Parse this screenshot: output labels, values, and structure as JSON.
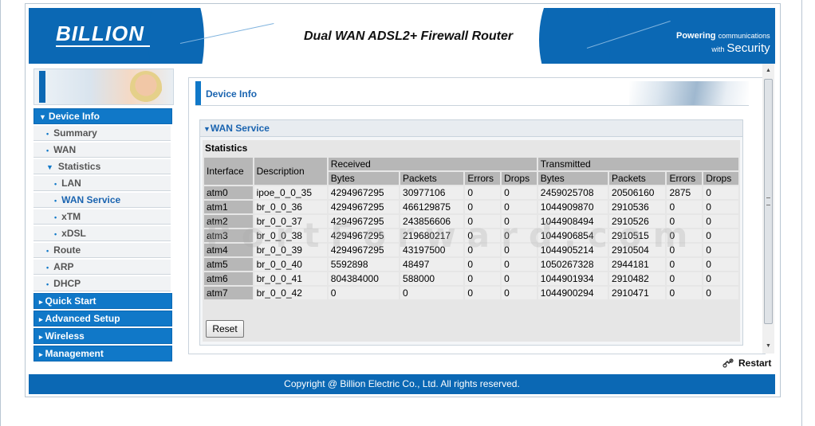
{
  "header": {
    "logo": "BILLION",
    "title": "Dual WAN ADSL2+ Firewall Router",
    "tagline_line1_a": "Powering",
    "tagline_line1_b": "communications",
    "tagline_line2_a": "with",
    "tagline_line2_b": "Security"
  },
  "sidebar": {
    "items": [
      {
        "label": "Device Info",
        "level": "head",
        "expanded": true
      },
      {
        "label": "Summary",
        "level": "sub1"
      },
      {
        "label": "WAN",
        "level": "sub1"
      },
      {
        "label": "Statistics",
        "level": "sub1",
        "expanded": true
      },
      {
        "label": "LAN",
        "level": "sub2"
      },
      {
        "label": "WAN Service",
        "level": "sub2",
        "active": true
      },
      {
        "label": "xTM",
        "level": "sub2"
      },
      {
        "label": "xDSL",
        "level": "sub2"
      },
      {
        "label": "Route",
        "level": "sub1"
      },
      {
        "label": "ARP",
        "level": "sub1"
      },
      {
        "label": "DHCP",
        "level": "sub1"
      },
      {
        "label": "Quick Start",
        "level": "head"
      },
      {
        "label": "Advanced Setup",
        "level": "head"
      },
      {
        "label": "Wireless",
        "level": "head"
      },
      {
        "label": "Management",
        "level": "head"
      }
    ]
  },
  "main": {
    "title": "Device Info",
    "section": "WAN Service",
    "stats_label": "Statistics",
    "headers": {
      "interface": "Interface",
      "description": "Description",
      "received": "Received",
      "transmitted": "Transmitted",
      "bytes": "Bytes",
      "packets": "Packets",
      "errors": "Errors",
      "drops": "Drops"
    },
    "rows": [
      [
        "atm0",
        "ipoe_0_0_35",
        "4294967295",
        "30977106",
        "0",
        "0",
        "2459025708",
        "20506160",
        "2875",
        "0"
      ],
      [
        "atm1",
        "br_0_0_36",
        "4294967295",
        "466129875",
        "0",
        "0",
        "1044909870",
        "2910536",
        "0",
        "0"
      ],
      [
        "atm2",
        "br_0_0_37",
        "4294967295",
        "243856606",
        "0",
        "0",
        "1044908494",
        "2910526",
        "0",
        "0"
      ],
      [
        "atm3",
        "br_0_0_38",
        "4294967295",
        "219680217",
        "0",
        "0",
        "1044906854",
        "2910515",
        "0",
        "0"
      ],
      [
        "atm4",
        "br_0_0_39",
        "4294967295",
        "43197500",
        "0",
        "0",
        "1044905214",
        "2910504",
        "0",
        "0"
      ],
      [
        "atm5",
        "br_0_0_40",
        "5592898",
        "48497",
        "0",
        "0",
        "1050267328",
        "2944181",
        "0",
        "0"
      ],
      [
        "atm6",
        "br_0_0_41",
        "804384000",
        "588000",
        "0",
        "0",
        "1044901934",
        "2910482",
        "0",
        "0"
      ],
      [
        "atm7",
        "br_0_0_42",
        "0",
        "0",
        "0",
        "0",
        "1044900294",
        "2910471",
        "0",
        "0"
      ]
    ],
    "reset_label": "Reset",
    "watermark": "PortForward.com"
  },
  "restart_label": "Restart",
  "footer": "Copyright @ Billion Electric Co., Ltd. All rights reserved.",
  "colors": {
    "brand_blue": "#0b68b4",
    "nav_head": "#1078c8",
    "link_blue": "#1a64b0",
    "table_header": "#b7b7b7",
    "table_cell": "#eeeeee"
  }
}
